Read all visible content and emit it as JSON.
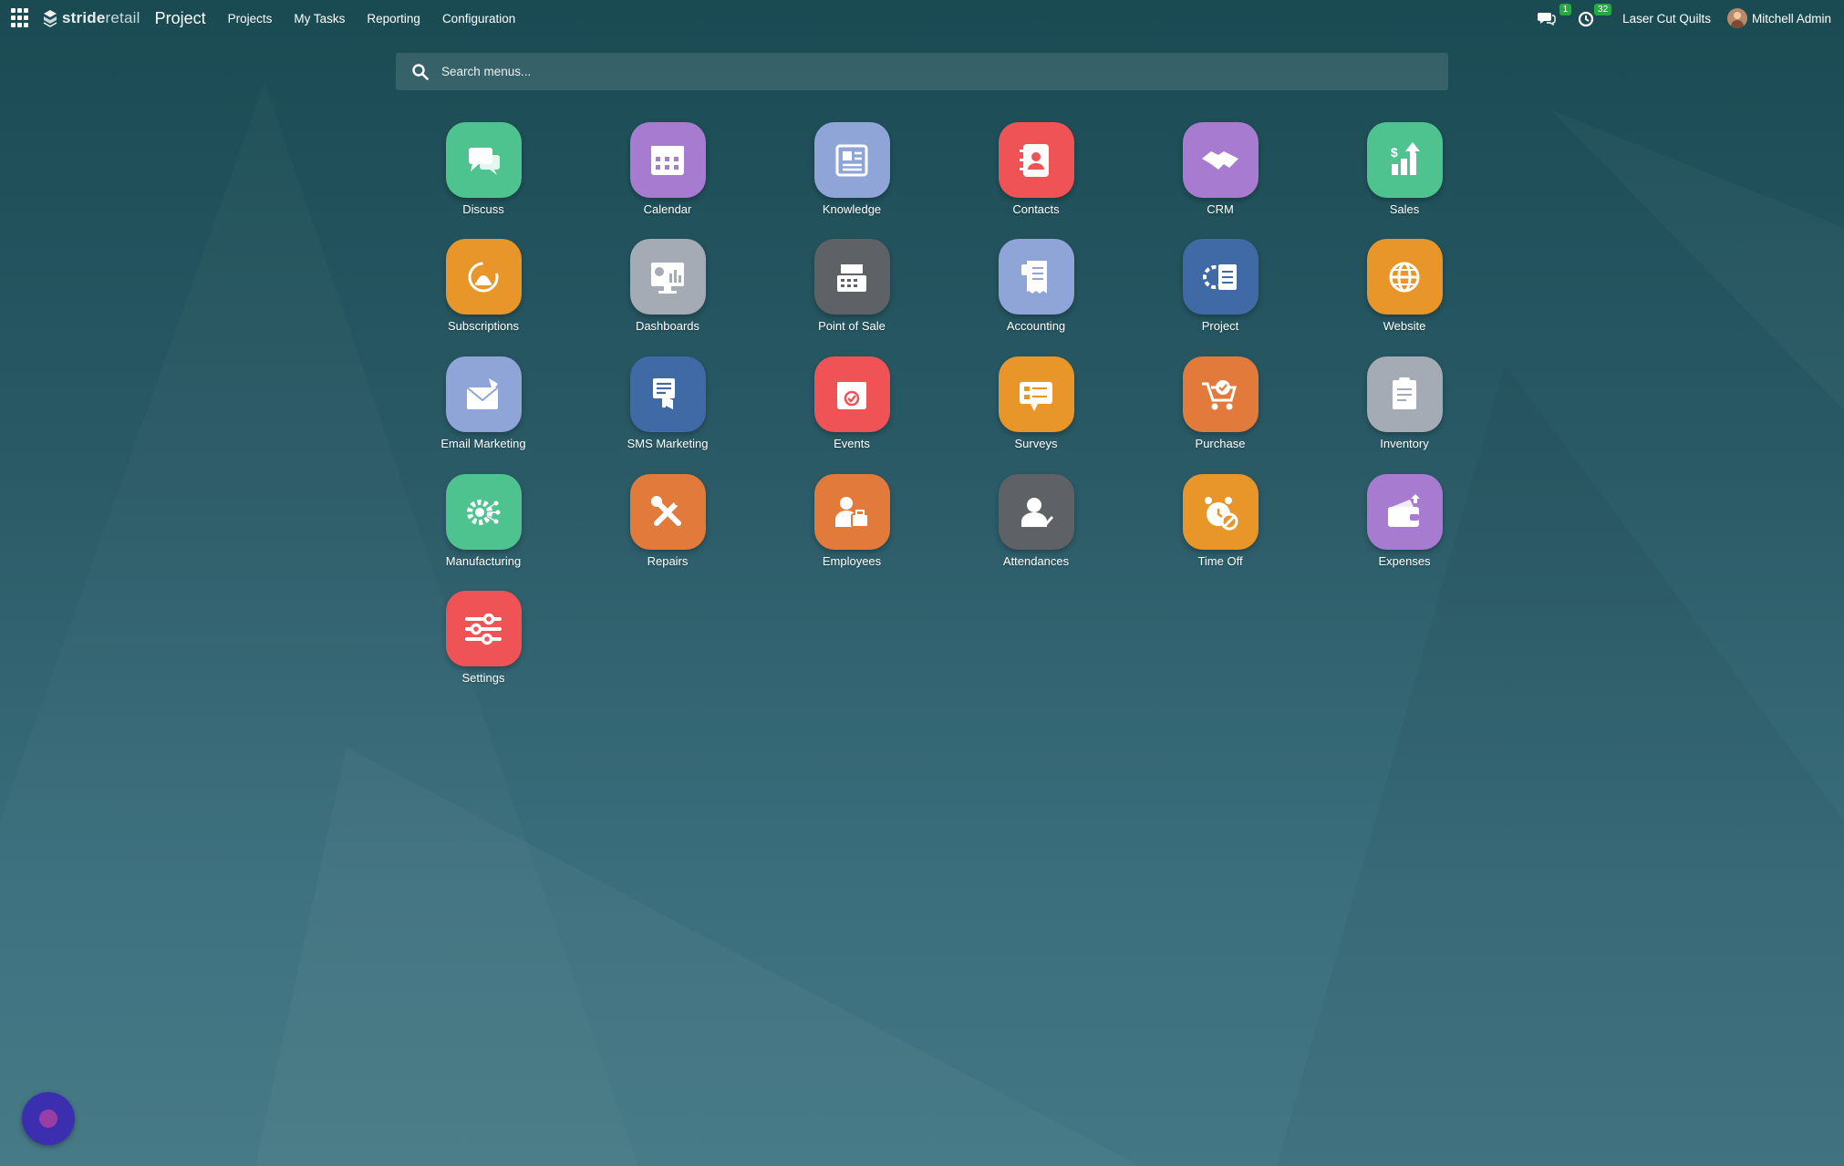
{
  "topbar": {
    "brand_bold": "stride",
    "brand_light": "retail",
    "app_name": "Project",
    "menu": [
      "Projects",
      "My Tasks",
      "Reporting",
      "Configuration"
    ],
    "messages_count": "1",
    "activities_count": "32",
    "company": "Laser Cut Quilts",
    "user": "Mitchell Admin"
  },
  "search": {
    "placeholder": "Search menus..."
  },
  "apps": [
    {
      "label": "Discuss",
      "icon": "discuss-icon",
      "color": "#4fc38f"
    },
    {
      "label": "Calendar",
      "icon": "calendar-icon",
      "color": "#a77bd0"
    },
    {
      "label": "Knowledge",
      "icon": "knowledge-icon",
      "color": "#8fa5d8"
    },
    {
      "label": "Contacts",
      "icon": "contacts-icon",
      "color": "#ef5356"
    },
    {
      "label": "CRM",
      "icon": "crm-icon",
      "color": "#a77bd0"
    },
    {
      "label": "Sales",
      "icon": "sales-icon",
      "color": "#4fc38f"
    },
    {
      "label": "Subscriptions",
      "icon": "subscriptions-icon",
      "color": "#e8962a"
    },
    {
      "label": "Dashboards",
      "icon": "dashboards-icon",
      "color": "#a5abb5"
    },
    {
      "label": "Point of Sale",
      "icon": "point-of-sale-icon",
      "color": "#5e6166"
    },
    {
      "label": "Accounting",
      "icon": "accounting-icon",
      "color": "#8fa5d8"
    },
    {
      "label": "Project",
      "icon": "project-icon",
      "color": "#3f6aa6"
    },
    {
      "label": "Website",
      "icon": "website-icon",
      "color": "#e8962a"
    },
    {
      "label": "Email Marketing",
      "icon": "email-marketing-icon",
      "color": "#8fa5d8"
    },
    {
      "label": "SMS Marketing",
      "icon": "sms-marketing-icon",
      "color": "#3f6aa6"
    },
    {
      "label": "Events",
      "icon": "events-icon",
      "color": "#ef5356"
    },
    {
      "label": "Surveys",
      "icon": "surveys-icon",
      "color": "#e8962a"
    },
    {
      "label": "Purchase",
      "icon": "purchase-icon",
      "color": "#e27a3c"
    },
    {
      "label": "Inventory",
      "icon": "inventory-icon",
      "color": "#a5abb5"
    },
    {
      "label": "Manufacturing",
      "icon": "manufacturing-icon",
      "color": "#4fc38f"
    },
    {
      "label": "Repairs",
      "icon": "repairs-icon",
      "color": "#e27a3c"
    },
    {
      "label": "Employees",
      "icon": "employees-icon",
      "color": "#e27a3c"
    },
    {
      "label": "Attendances",
      "icon": "attendances-icon",
      "color": "#5e6166"
    },
    {
      "label": "Time Off",
      "icon": "time-off-icon",
      "color": "#e8962a"
    },
    {
      "label": "Expenses",
      "icon": "expenses-icon",
      "color": "#a77bd0"
    },
    {
      "label": "Settings",
      "icon": "settings-icon",
      "color": "#ef5356"
    }
  ]
}
